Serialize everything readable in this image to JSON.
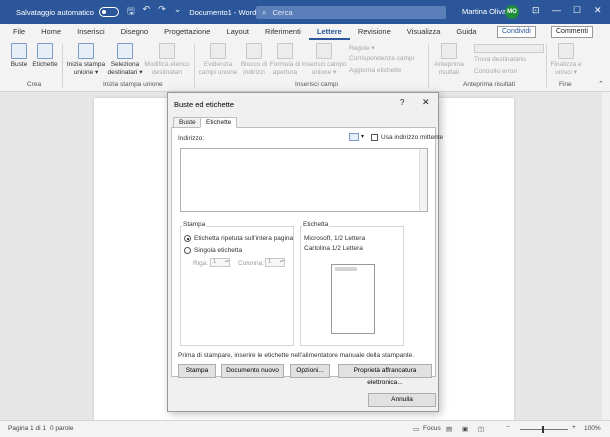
{
  "titlebar": {
    "autosave_label": "Salvataggio automatico",
    "doc_title": "Documento1 - Word",
    "search_placeholder": "Cerca",
    "user_name": "Martina Oliva",
    "user_initials": "MO"
  },
  "tabs": [
    "File",
    "Home",
    "Inserisci",
    "Disegno",
    "Progettazione",
    "Layout",
    "Riferimenti",
    "Lettere",
    "Revisione",
    "Visualizza",
    "Guida"
  ],
  "active_tab": "Lettere",
  "share_label": "Condividi",
  "comments_label": "Commenti",
  "ribbon": {
    "crea": {
      "group": "Crea",
      "buste": "Buste",
      "etichette": "Etichette"
    },
    "stampa_unione": {
      "group": "Inizia stampa unione",
      "inizia_1": "Inizia stampa",
      "inizia_2": "unione ▾",
      "seleziona_1": "Seleziona",
      "seleziona_2": "destinatari ▾",
      "modifica_1": "Modifica elenco",
      "modifica_2": "destinatari"
    },
    "campi": {
      "group": "Inserisci campi",
      "evidenzia_1": "Evidenzia",
      "evidenzia_2": "campi unione",
      "blocco_1": "Blocco di",
      "blocco_2": "indirizzi",
      "formula_1": "Formula di",
      "formula_2": "apertura",
      "inserisci_1": "Inserisci campo",
      "inserisci_2": "unione ▾",
      "regole": "Regole ▾",
      "corrispondenza": "Corrispondenza campi",
      "aggiorna": "Aggiorna etichette"
    },
    "anteprima": {
      "group": "Anteprima risultati",
      "anteprima_1": "Anteprima",
      "anteprima_2": "risultati",
      "trova": "Trova destinatario",
      "controllo": "Controllo errori"
    },
    "fine": {
      "group": "Fine",
      "finalizza_1": "Finalizza e",
      "finalizza_2": "unisci ▾"
    }
  },
  "dialog": {
    "title": "Buste ed etichette",
    "help": "?",
    "close": "✕",
    "tab_buste": "Buste",
    "tab_etichette": "Etichette",
    "indirizzo_label": "Indirizzo:",
    "usa_mittente": "Usa indirizzo mittente",
    "stampa_legend": "Stampa",
    "radio_full": "Etichetta ripetuta sull'intera pagina",
    "radio_single": "Singola etichetta",
    "riga_label": "Riga:",
    "riga_value": "1",
    "colonna_label": "Colonna:",
    "colonna_value": "1",
    "etichetta_legend": "Etichetta",
    "label_line1": "Microsoft, 1/2 Lettera",
    "label_line2": "Cartolina 1/2 Lettera",
    "note": "Prima di stampare, inserire le etichette nell'alimentatore manuale della stampante.",
    "btn_stampa": "Stampa",
    "btn_nuovo": "Documento nuovo",
    "btn_opzioni": "Opzioni...",
    "btn_affrancatura": "Proprietà affrancatura elettronica...",
    "btn_annulla": "Annulla"
  },
  "status": {
    "page": "Pagina 1 di 1",
    "words": "0 parole",
    "focus": "Focus",
    "zoom": "100%"
  },
  "colors": {
    "accent": "#2b579a",
    "avatar": "#1e8c3a"
  }
}
